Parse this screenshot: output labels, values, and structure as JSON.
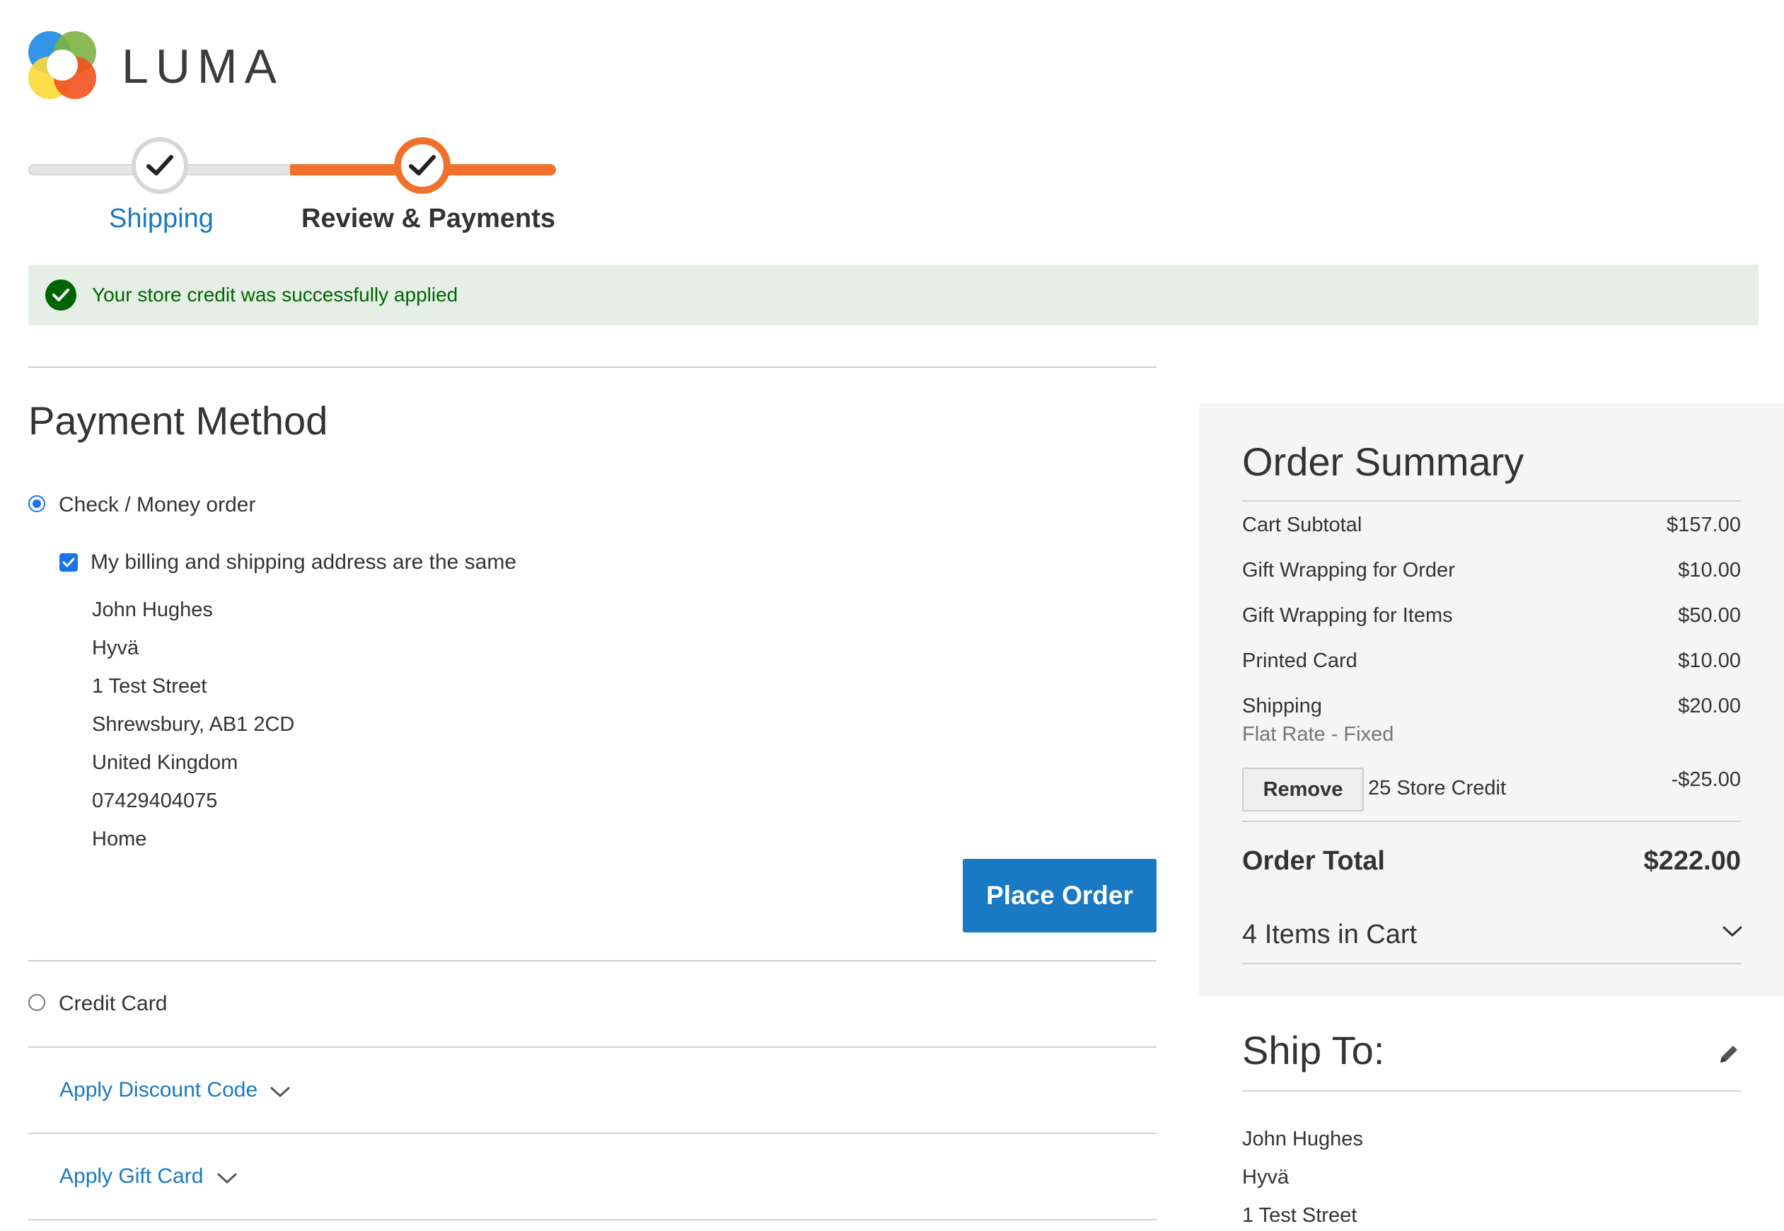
{
  "brand": {
    "name": "LUMA",
    "colors": {
      "blue": "#1e88e5",
      "green": "#7cb342",
      "yellow": "#fdd835",
      "orange": "#f4511e"
    }
  },
  "progress": {
    "steps": [
      {
        "label": "Shipping",
        "state": "complete"
      },
      {
        "label": "Review & Payments",
        "state": "active"
      }
    ],
    "accent": "#f0712b"
  },
  "message": {
    "text": "Your store credit was successfully applied",
    "icon": "check-circle-icon"
  },
  "payment": {
    "title": "Payment Method",
    "methods": [
      {
        "label": "Check / Money order",
        "selected": true
      },
      {
        "label": "Credit Card",
        "selected": false
      }
    ],
    "same_address_label": "My billing and shipping address are the same",
    "same_address_checked": true,
    "billing_address": {
      "name": "John Hughes",
      "company": "Hyvä",
      "street": "1 Test Street",
      "city_line": "Shrewsbury, AB1 2CD",
      "country": "United Kingdom",
      "phone": "07429404075",
      "type": "Home"
    },
    "place_order_label": "Place Order",
    "discount_label": "Apply Discount Code",
    "gift_card_label": "Apply Gift Card"
  },
  "summary": {
    "title": "Order Summary",
    "rows": [
      {
        "label": "Cart Subtotal",
        "value": "$157.00"
      },
      {
        "label": "Gift Wrapping for Order",
        "value": "$10.00"
      },
      {
        "label": "Gift Wrapping for Items",
        "value": "$50.00"
      },
      {
        "label": "Printed Card",
        "value": "$10.00"
      },
      {
        "label": "Shipping",
        "value": "$20.00",
        "note": "Flat Rate - Fixed"
      }
    ],
    "store_credit": {
      "remove_label": "Remove",
      "label": "25 Store Credit",
      "value": "-$25.00"
    },
    "total_label": "Order Total",
    "total_value": "$222.00",
    "items_in_cart": "4 Items in Cart"
  },
  "ship_to": {
    "title": "Ship To:",
    "name": "John Hughes",
    "company": "Hyvä",
    "street": "1 Test Street"
  }
}
